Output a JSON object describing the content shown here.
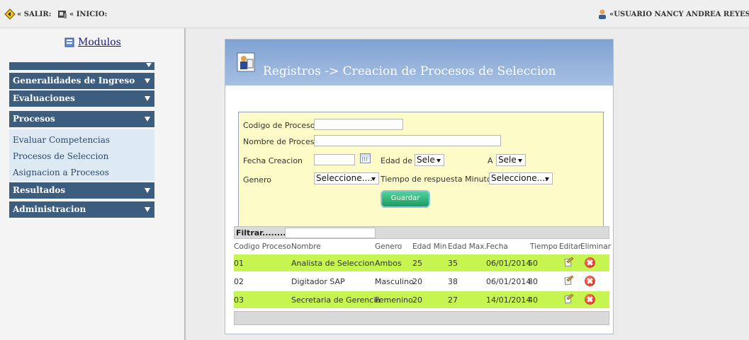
{
  "topbar": {
    "exit_label": "« SALIR:",
    "home_label": "« INICIO:",
    "user_label": "«USUARIO NANCY ANDREA REYES LU"
  },
  "sidebar": {
    "modules_label": "Modulos",
    "menu": [
      {
        "label": "Generalidades de Ingreso"
      },
      {
        "label": "Evaluaciones"
      },
      {
        "label": "Procesos"
      },
      {
        "label": "Resultados"
      },
      {
        "label": "Administracion"
      }
    ],
    "submenu": [
      {
        "label": "Evaluar Competencias"
      },
      {
        "label": "Procesos de Seleccion"
      },
      {
        "label": "Asignacion a Procesos"
      }
    ]
  },
  "panel": {
    "title": "Registros -> Creacion de Procesos de Seleccion"
  },
  "form": {
    "codigo_label": "Codigo de Proceso",
    "codigo_value": "",
    "nombre_label": "Nombre de Proceso",
    "nombre_value": "",
    "fecha_label": "Fecha Creacion",
    "fecha_value": "",
    "edad_de_label": "Edad de",
    "edad_de_value": "Sele",
    "a_label": "A",
    "a_value": "Sele",
    "genero_label": "Genero",
    "genero_value": "Seleccione....",
    "tiempo_label": "Tiempo de respuesta Minutos",
    "tiempo_value": "Seleccione....",
    "save_label": "Guardar"
  },
  "grid": {
    "filter_label": "Filtrar.........:",
    "filter_value": "",
    "columns": [
      "Codigo Proceso",
      "Nombre",
      "Genero",
      "Edad Min",
      "Edad Max.",
      "Fecha",
      "Tiempo",
      "Editar",
      "Eliminar"
    ],
    "rows": [
      {
        "codigo": "01",
        "nombre": "Analista de Seleccion",
        "genero": "Ambos",
        "edad_min": "25",
        "edad_max": "35",
        "fecha": "06/01/2014",
        "tiempo": "50"
      },
      {
        "codigo": "02",
        "nombre": "Digitador SAP",
        "genero": "Masculino",
        "edad_min": "20",
        "edad_max": "38",
        "fecha": "06/01/2014",
        "tiempo": "80"
      },
      {
        "codigo": "03",
        "nombre": "Secretaria de Gerencia",
        "genero": "Femenino",
        "edad_min": "20",
        "edad_max": "27",
        "fecha": "14/01/2014",
        "tiempo": "40"
      }
    ]
  },
  "colors": {
    "menu_bg": "#3d5d7e",
    "submenu_bg": "#dde9f3",
    "header_gradient_top": "#7fa2d3",
    "form_bg": "#fdfcc8",
    "row_highlight": "#c6f450",
    "button_green": "#1d9a62",
    "delete_red": "#c81e0e"
  },
  "icons": {
    "exit": "exit-diamond-icon",
    "home": "home-icon",
    "user": "user-icon",
    "modules": "modules-book-icon",
    "panel": "registry-person-icon",
    "calendar": "calendar-icon",
    "edit": "edit-icon",
    "delete": "delete-icon"
  }
}
